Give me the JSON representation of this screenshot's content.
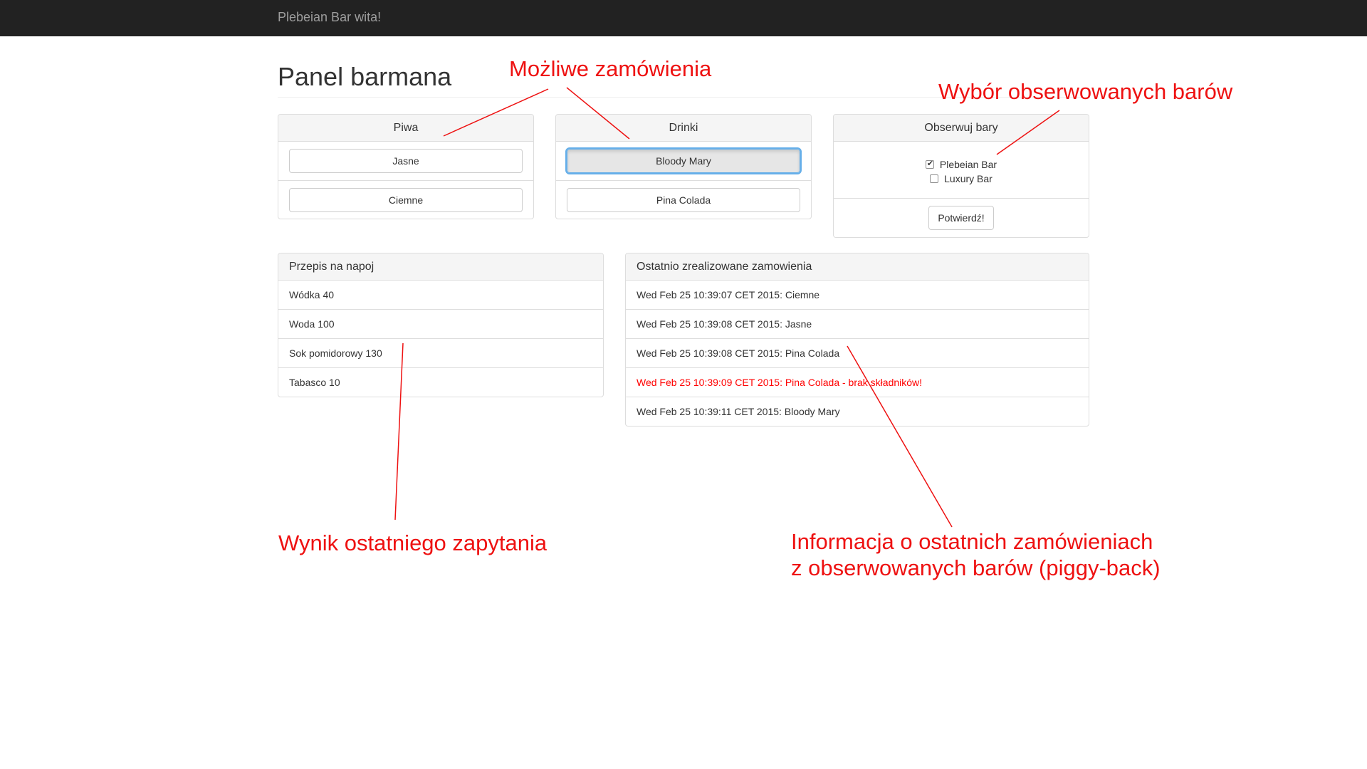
{
  "navbar": {
    "brand": "Plebeian Bar wita!"
  },
  "page": {
    "title": "Panel barmana"
  },
  "beers": {
    "heading": "Piwa",
    "items": [
      "Jasne",
      "Ciemne"
    ]
  },
  "drinks": {
    "heading": "Drinki",
    "items": [
      "Bloody Mary",
      "Pina Colada"
    ],
    "active_item": "Bloody Mary"
  },
  "bars": {
    "heading": "Obserwuj bary",
    "options": [
      {
        "label": "Plebeian Bar",
        "checked": true
      },
      {
        "label": "Luxury Bar",
        "checked": false
      }
    ],
    "confirm_label": "Potwierdź!"
  },
  "recipe": {
    "heading": "Przepis na napoj",
    "items": [
      "Wódka 40",
      "Woda 100",
      "Sok pomidorowy 130",
      "Tabasco 10"
    ]
  },
  "orders": {
    "heading": "Ostatnio zrealizowane zamowienia",
    "items": [
      "Wed Feb 25 10:39:07 CET 2015: Ciemne",
      "Wed Feb 25 10:39:08 CET 2015: Jasne",
      "Wed Feb 25 10:39:08 CET 2015: Pina Colada",
      "Wed Feb 25 10:39:09 CET 2015: Pina Colada - brak składników!",
      "Wed Feb 25 10:39:11 CET 2015: Bloody Mary"
    ],
    "error_color": "#ff0000"
  },
  "annotations": {
    "orders_possible": "Możliwe zamówienia",
    "bar_choice": "Wybór obserwowanych barów",
    "last_query": "Wynik ostatniego zapytania",
    "piggyback_line1": "Informacja o ostatnich zamówieniach",
    "piggyback_line2": "z obserwowanych barów (piggy-back)",
    "color": "#ee1111"
  }
}
